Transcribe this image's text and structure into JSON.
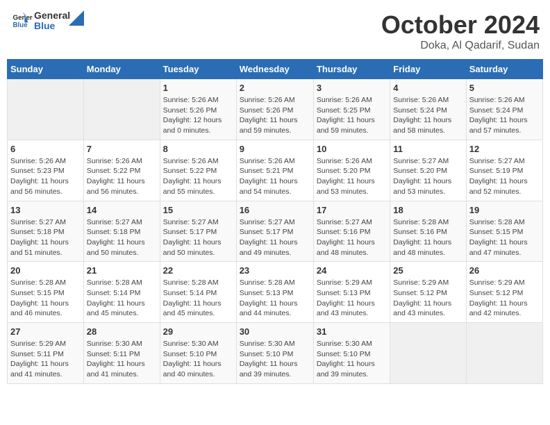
{
  "header": {
    "logo_general": "General",
    "logo_blue": "Blue",
    "month_title": "October 2024",
    "location": "Doka, Al Qadarif, Sudan"
  },
  "weekdays": [
    "Sunday",
    "Monday",
    "Tuesday",
    "Wednesday",
    "Thursday",
    "Friday",
    "Saturday"
  ],
  "weeks": [
    [
      {
        "day": "",
        "info": ""
      },
      {
        "day": "",
        "info": ""
      },
      {
        "day": "1",
        "info": "Sunrise: 5:26 AM\nSunset: 5:26 PM\nDaylight: 12 hours and 0 minutes."
      },
      {
        "day": "2",
        "info": "Sunrise: 5:26 AM\nSunset: 5:26 PM\nDaylight: 11 hours and 59 minutes."
      },
      {
        "day": "3",
        "info": "Sunrise: 5:26 AM\nSunset: 5:25 PM\nDaylight: 11 hours and 59 minutes."
      },
      {
        "day": "4",
        "info": "Sunrise: 5:26 AM\nSunset: 5:24 PM\nDaylight: 11 hours and 58 minutes."
      },
      {
        "day": "5",
        "info": "Sunrise: 5:26 AM\nSunset: 5:24 PM\nDaylight: 11 hours and 57 minutes."
      }
    ],
    [
      {
        "day": "6",
        "info": "Sunrise: 5:26 AM\nSunset: 5:23 PM\nDaylight: 11 hours and 56 minutes."
      },
      {
        "day": "7",
        "info": "Sunrise: 5:26 AM\nSunset: 5:22 PM\nDaylight: 11 hours and 56 minutes."
      },
      {
        "day": "8",
        "info": "Sunrise: 5:26 AM\nSunset: 5:22 PM\nDaylight: 11 hours and 55 minutes."
      },
      {
        "day": "9",
        "info": "Sunrise: 5:26 AM\nSunset: 5:21 PM\nDaylight: 11 hours and 54 minutes."
      },
      {
        "day": "10",
        "info": "Sunrise: 5:26 AM\nSunset: 5:20 PM\nDaylight: 11 hours and 53 minutes."
      },
      {
        "day": "11",
        "info": "Sunrise: 5:27 AM\nSunset: 5:20 PM\nDaylight: 11 hours and 53 minutes."
      },
      {
        "day": "12",
        "info": "Sunrise: 5:27 AM\nSunset: 5:19 PM\nDaylight: 11 hours and 52 minutes."
      }
    ],
    [
      {
        "day": "13",
        "info": "Sunrise: 5:27 AM\nSunset: 5:18 PM\nDaylight: 11 hours and 51 minutes."
      },
      {
        "day": "14",
        "info": "Sunrise: 5:27 AM\nSunset: 5:18 PM\nDaylight: 11 hours and 50 minutes."
      },
      {
        "day": "15",
        "info": "Sunrise: 5:27 AM\nSunset: 5:17 PM\nDaylight: 11 hours and 50 minutes."
      },
      {
        "day": "16",
        "info": "Sunrise: 5:27 AM\nSunset: 5:17 PM\nDaylight: 11 hours and 49 minutes."
      },
      {
        "day": "17",
        "info": "Sunrise: 5:27 AM\nSunset: 5:16 PM\nDaylight: 11 hours and 48 minutes."
      },
      {
        "day": "18",
        "info": "Sunrise: 5:28 AM\nSunset: 5:16 PM\nDaylight: 11 hours and 48 minutes."
      },
      {
        "day": "19",
        "info": "Sunrise: 5:28 AM\nSunset: 5:15 PM\nDaylight: 11 hours and 47 minutes."
      }
    ],
    [
      {
        "day": "20",
        "info": "Sunrise: 5:28 AM\nSunset: 5:15 PM\nDaylight: 11 hours and 46 minutes."
      },
      {
        "day": "21",
        "info": "Sunrise: 5:28 AM\nSunset: 5:14 PM\nDaylight: 11 hours and 45 minutes."
      },
      {
        "day": "22",
        "info": "Sunrise: 5:28 AM\nSunset: 5:14 PM\nDaylight: 11 hours and 45 minutes."
      },
      {
        "day": "23",
        "info": "Sunrise: 5:28 AM\nSunset: 5:13 PM\nDaylight: 11 hours and 44 minutes."
      },
      {
        "day": "24",
        "info": "Sunrise: 5:29 AM\nSunset: 5:13 PM\nDaylight: 11 hours and 43 minutes."
      },
      {
        "day": "25",
        "info": "Sunrise: 5:29 AM\nSunset: 5:12 PM\nDaylight: 11 hours and 43 minutes."
      },
      {
        "day": "26",
        "info": "Sunrise: 5:29 AM\nSunset: 5:12 PM\nDaylight: 11 hours and 42 minutes."
      }
    ],
    [
      {
        "day": "27",
        "info": "Sunrise: 5:29 AM\nSunset: 5:11 PM\nDaylight: 11 hours and 41 minutes."
      },
      {
        "day": "28",
        "info": "Sunrise: 5:30 AM\nSunset: 5:11 PM\nDaylight: 11 hours and 41 minutes."
      },
      {
        "day": "29",
        "info": "Sunrise: 5:30 AM\nSunset: 5:10 PM\nDaylight: 11 hours and 40 minutes."
      },
      {
        "day": "30",
        "info": "Sunrise: 5:30 AM\nSunset: 5:10 PM\nDaylight: 11 hours and 39 minutes."
      },
      {
        "day": "31",
        "info": "Sunrise: 5:30 AM\nSunset: 5:10 PM\nDaylight: 11 hours and 39 minutes."
      },
      {
        "day": "",
        "info": ""
      },
      {
        "day": "",
        "info": ""
      }
    ]
  ]
}
